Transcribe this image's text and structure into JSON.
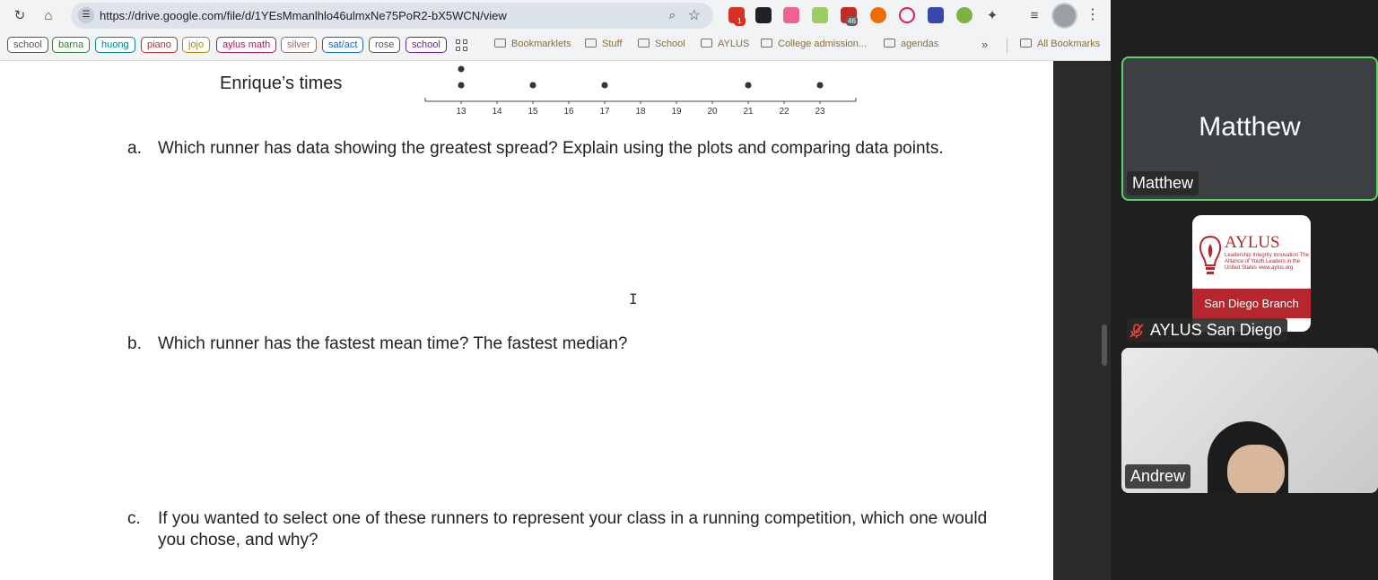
{
  "browser": {
    "url": "https://drive.google.com/file/d/1YEsMmanlhlo46ulmxNe75PoR2-bX5WCN/view",
    "ext_badges": [
      "1",
      "46"
    ],
    "bookmark_chips": [
      {
        "label": "school",
        "color": "#555555"
      },
      {
        "label": "barna",
        "color": "#2e7d32"
      },
      {
        "label": "huong",
        "color": "#00838f"
      },
      {
        "label": "piano",
        "color": "#c62828"
      },
      {
        "label": "jojo",
        "color": "#b08900"
      },
      {
        "label": "aylus math",
        "color": "#ad1457"
      },
      {
        "label": "silver",
        "color": "#8d6e63"
      },
      {
        "label": "sat/act",
        "color": "#1565c0"
      },
      {
        "label": "rose",
        "color": "#555555"
      },
      {
        "label": "school",
        "color": "#6a1b9a"
      }
    ],
    "bookmark_folders": [
      "Bookmarklets",
      "Stuff",
      "School",
      "AYLUS",
      "College admission...",
      "agendas"
    ],
    "all_bookmarks": "All Bookmarks"
  },
  "document": {
    "plot_label": "Enrique’s times",
    "chart_data": {
      "type": "scatter",
      "subtype": "dot-plot",
      "series": [
        {
          "name": "Enrique’s times",
          "values": [
            13,
            13,
            15,
            17,
            21,
            23
          ]
        }
      ],
      "x_ticks": [
        "13",
        "14",
        "15",
        "16",
        "17",
        "18",
        "19",
        "20",
        "21",
        "22",
        "23"
      ],
      "xlim": [
        12,
        24
      ]
    },
    "questions": [
      {
        "letter": "a.",
        "text": "Which runner has data showing the greatest spread?  Explain using the plots and comparing data points."
      },
      {
        "letter": "b.",
        "text": "Which runner has the fastest mean time?   The fastest median?"
      },
      {
        "letter": "c.",
        "text": "If you wanted to select one of these runners to represent your class in a running competition, which one would you chose, and why?"
      }
    ]
  },
  "meeting": {
    "participants": [
      {
        "tile_name": "Matthew",
        "tag": "Matthew"
      },
      {
        "tag": "AYLUS San Diego",
        "muted": true
      },
      {
        "tag": "Andrew"
      }
    ],
    "aylus_logo": {
      "word": "AYLUS",
      "tagline": "Leadership Integrity Innovation The Alliance of Youth Leaders in the United States www.aylus.org",
      "branch": "San Diego Branch"
    }
  }
}
